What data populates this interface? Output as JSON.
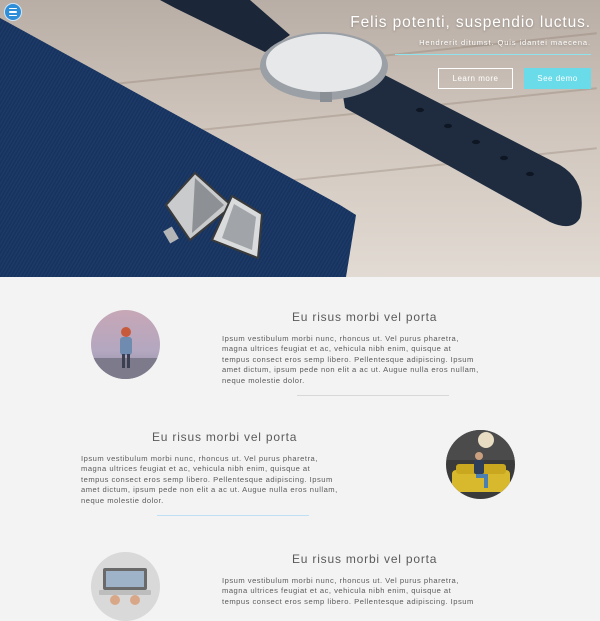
{
  "hero": {
    "title": "Felis potenti, suspendio luctus.",
    "subtitle": "Hendrerit ditumst. Quis idantei maecena.",
    "primary_button": "Learn more",
    "secondary_button": "See demo",
    "accent_color": "#69dbe9",
    "menu_icon": "hamburger-icon"
  },
  "features": [
    {
      "title": "Eu risus morbi vel porta",
      "lines": [
        "Ipsum vestibulum morbi nunc, rhoncus ut. Vel purus pharetra,",
        "magna ultrices feugiat et ac, vehicula nibh enim, quisque at",
        "tempus consect eros semp libero. Pellentesque adipiscing. Ipsum",
        "amet dictum, ipsum pede non elit a ac ut. Augue nulla eros nullam,",
        "neque molestie dolor."
      ]
    },
    {
      "title": "Eu risus morbi vel porta",
      "lines": [
        "Ipsum vestibulum morbi nunc, rhoncus ut. Vel purus pharetra,",
        "magna ultrices feugiat et ac, vehicula nibh enim, quisque at",
        "tempus consect eros semp libero. Pellentesque adipiscing. Ipsum",
        "amet dictum, ipsum pede non elit a ac ut. Augue nulla eros nullam,",
        "neque molestie dolor."
      ]
    },
    {
      "title": "Eu risus morbi vel porta",
      "lines": [
        "Ipsum vestibulum morbi nunc, rhoncus ut. Vel purus pharetra,",
        "magna ultrices feugiat et ac, vehicula nibh enim, quisque at",
        "tempus consect eros semp libero. Pellentesque adipiscing. Ipsum"
      ]
    }
  ]
}
